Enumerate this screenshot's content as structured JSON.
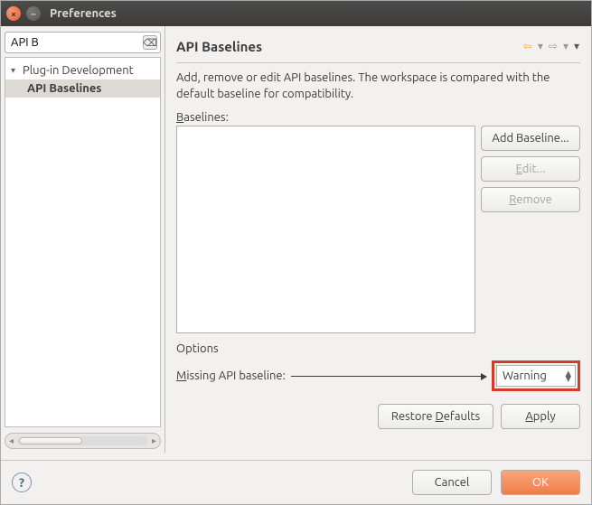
{
  "window": {
    "title": "Preferences"
  },
  "search": {
    "value": "API B"
  },
  "sidebar": {
    "items": [
      {
        "label": "Plug-in Development",
        "children": [
          {
            "label": "API Baselines"
          }
        ]
      }
    ]
  },
  "page": {
    "title": "API Baselines",
    "description": "Add, remove or edit API baselines. The workspace is compared with the default baseline for compatibility.",
    "baselines_label": "Baselines:",
    "buttons": {
      "add": "Add Baseline...",
      "edit": "Edit...",
      "remove": "Remove"
    },
    "options_label": "Options",
    "missing_label": "Missing API baseline:",
    "missing_value": "Warning",
    "restore_defaults": "Restore Defaults",
    "apply": "Apply"
  },
  "footer": {
    "cancel": "Cancel",
    "ok": "OK"
  }
}
